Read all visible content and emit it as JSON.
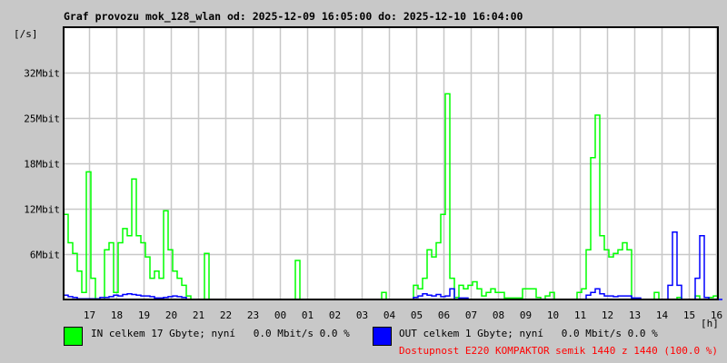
{
  "chart_data": {
    "type": "line",
    "title": "Graf provozu mok_128_wlan od: 2025-12-09 16:05:00 do: 2025-12-10 16:04:00",
    "ylabel": "[/s]",
    "xlabel": "[h]",
    "ylim": [
      0,
      38.4
    ],
    "y_ticks": [
      {
        "value": 6.4,
        "label": "6Mbit"
      },
      {
        "value": 12.8,
        "label": "12Mbit"
      },
      {
        "value": 19.2,
        "label": "18Mbit"
      },
      {
        "value": 25.6,
        "label": "25Mbit"
      },
      {
        "value": 32,
        "label": "32Mbit"
      }
    ],
    "x_start_minute_offset": 55,
    "x_step_minutes": 10,
    "x_total_minutes": 1440,
    "x_tick_labels": [
      "17",
      "18",
      "19",
      "20",
      "21",
      "22",
      "23",
      "00",
      "01",
      "02",
      "03",
      "04",
      "05",
      "06",
      "07",
      "08",
      "09",
      "10",
      "11",
      "12",
      "13",
      "14",
      "15",
      "16"
    ],
    "grid": true,
    "series": [
      {
        "name": "IN",
        "color": "#00ff00",
        "unit": "Mbit/s",
        "values": [
          12,
          8,
          6.5,
          4,
          1,
          18,
          3,
          0,
          0,
          7,
          8,
          1,
          8,
          10,
          9,
          17,
          9,
          8,
          6,
          3,
          4,
          3,
          12.5,
          7,
          4,
          3,
          2,
          0.5,
          0,
          0,
          0,
          6.5,
          0,
          0,
          0,
          0,
          0,
          0,
          0,
          0,
          0,
          0,
          0,
          0,
          0,
          0,
          0,
          0,
          0,
          0,
          0,
          5.5,
          0,
          0,
          0,
          0,
          0,
          0,
          0,
          0,
          0,
          0,
          0,
          0,
          0,
          0,
          0,
          0,
          0,
          0,
          1,
          0,
          0,
          0,
          0,
          0,
          0,
          2,
          1.5,
          3,
          7,
          6,
          8,
          12,
          29,
          3,
          0.3,
          2,
          1.5,
          2,
          2.5,
          1.5,
          0.5,
          1,
          1.5,
          1,
          1,
          0.2,
          0.2,
          0.2,
          0.2,
          1.5,
          1.5,
          1.5,
          0.3,
          0,
          0.5,
          1,
          0,
          0,
          0,
          0,
          0,
          1,
          1.5,
          7,
          20,
          26,
          9,
          7,
          6,
          6.5,
          7,
          8,
          7,
          0,
          0,
          0,
          0,
          0,
          1,
          0,
          0,
          0,
          0,
          0.3,
          0,
          0,
          0,
          0.5,
          0,
          0,
          0.3,
          0.5
        ]
      },
      {
        "name": "OUT",
        "color": "#0000ff",
        "unit": "Mbit/s",
        "values": [
          0.6,
          0.4,
          0.3,
          0.1,
          0.1,
          0.1,
          0.1,
          0.1,
          0.3,
          0.3,
          0.4,
          0.6,
          0.5,
          0.7,
          0.8,
          0.7,
          0.6,
          0.5,
          0.5,
          0.4,
          0.2,
          0.2,
          0.3,
          0.4,
          0.5,
          0.4,
          0.3,
          0,
          0,
          0,
          0,
          0,
          0,
          0,
          0,
          0,
          0,
          0,
          0,
          0,
          0,
          0,
          0,
          0,
          0,
          0,
          0,
          0,
          0,
          0,
          0,
          0,
          0,
          0,
          0,
          0,
          0,
          0,
          0,
          0,
          0,
          0,
          0,
          0,
          0,
          0,
          0,
          0,
          0,
          0,
          0,
          0,
          0,
          0,
          0,
          0,
          0,
          0.3,
          0.5,
          0.8,
          0.6,
          0.5,
          0.7,
          0.4,
          0.5,
          1.5,
          0,
          0.2,
          0.2,
          0,
          0,
          0,
          0,
          0,
          0,
          0,
          0,
          0,
          0,
          0,
          0,
          0,
          0,
          0,
          0,
          0,
          0,
          0,
          0,
          0,
          0,
          0,
          0,
          0,
          0,
          0.6,
          1,
          1.5,
          0.8,
          0.5,
          0.5,
          0.4,
          0.5,
          0.5,
          0.5,
          0.2,
          0.2,
          0,
          0,
          0,
          0,
          0,
          0,
          2,
          9.5,
          2,
          0,
          0,
          0,
          3,
          9,
          0.3,
          0,
          0,
          0
        ]
      }
    ]
  },
  "legend": {
    "in_text": "IN celkem 17 Gbyte; nyní   0.0 Mbit/s 0.0 %",
    "out_text": "OUT celkem 1 Gbyte; nyní   0.0 Mbit/s 0.0 %",
    "availability_text": "Dostupnost E220 KOMPAKTOR semik 1440 z 1440 (100.0 %)",
    "availability_color": "#ff0000"
  }
}
